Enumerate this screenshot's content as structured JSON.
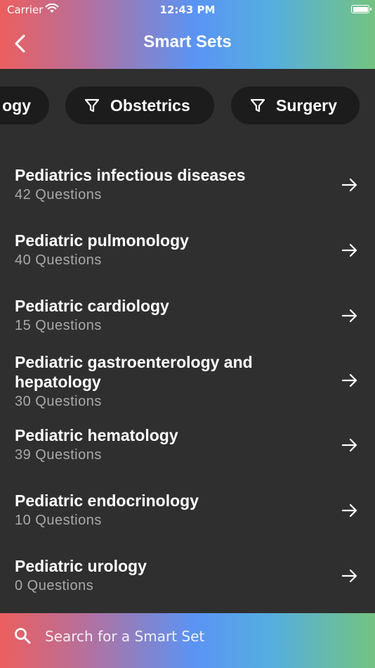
{
  "status_bar": {
    "carrier": "Carrier",
    "time": "12:43 PM"
  },
  "nav": {
    "title": "Smart Sets"
  },
  "filters": [
    "ogy",
    "Obstetrics",
    "Surgery"
  ],
  "sets": [
    {
      "title": "Pediatrics infectious diseases",
      "questions": "42 Questions"
    },
    {
      "title": "Pediatric pulmonology",
      "questions": "40 Questions"
    },
    {
      "title": "Pediatric cardiology",
      "questions": "15 Questions"
    },
    {
      "title": "Pediatric gastroenterology and hepatology",
      "questions": "30 Questions"
    },
    {
      "title": "Pediatric hematology",
      "questions": "39 Questions"
    },
    {
      "title": "Pediatric endocrinology",
      "questions": "10 Questions"
    },
    {
      "title": "Pediatric urology",
      "questions": "0 Questions"
    }
  ],
  "search": {
    "placeholder": "Search for a Smart Set",
    "value": ""
  },
  "icons": {
    "back": "chevron-left-icon",
    "filter": "funnel-icon",
    "row": "arrow-right-icon",
    "search": "search-icon"
  },
  "colors": {
    "background": "#2f2f2f",
    "chip": "#1c1c1c",
    "subtitle": "#a9a9a9",
    "gradient": [
      "#ec5f5f",
      "#b86f9a",
      "#5a94f5",
      "#55aee0",
      "#74c381"
    ]
  }
}
